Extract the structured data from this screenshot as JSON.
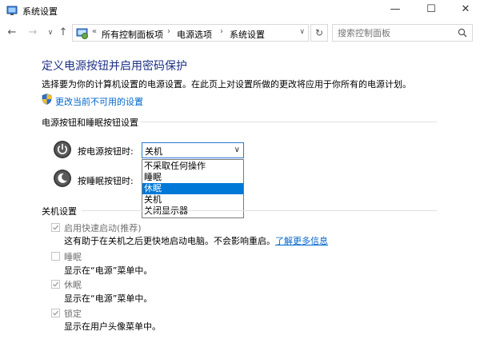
{
  "window": {
    "title": "系统设置",
    "minimize": "—",
    "maximize": "☐",
    "close": "✕"
  },
  "address": {
    "overflow": "«",
    "crumbs": [
      "所有控制面板项",
      "电源选项",
      "系统设置"
    ],
    "search_placeholder": "搜索控制面板"
  },
  "page": {
    "title": "定义电源按钮并启用密码保护",
    "description": "选择要为你的计算机设置的电源设置。在此页上对设置所做的更改将应用于你所有的电源计划。",
    "change_link": "更改当前不可用的设置"
  },
  "power_section": {
    "header": "电源按钮和睡眠按钮设置",
    "power_button_label": "按电源按钮时:",
    "power_button_value": "关机",
    "sleep_button_label": "按睡眠按钮时:",
    "dropdown_options": [
      "不采取任何操作",
      "睡眠",
      "休眠",
      "关机",
      "关闭显示器"
    ],
    "selected_option_index": 2
  },
  "shutdown_section": {
    "header": "关机设置",
    "items": [
      {
        "label": "启用快速启动(推荐)",
        "checked": true,
        "desc": "这有助于在关机之后更快地启动电脑。不会影响重启。",
        "link": "了解更多信息"
      },
      {
        "label": "睡眠",
        "checked": false,
        "desc": "显示在“电源”菜单中。"
      },
      {
        "label": "休眠",
        "checked": true,
        "desc": "显示在“电源”菜单中。"
      },
      {
        "label": "锁定",
        "checked": true,
        "desc": "显示在用户头像菜单中。"
      }
    ]
  },
  "colors": {
    "heading": "#1e3287",
    "link": "#0066cc",
    "selection": "#0078d7"
  }
}
